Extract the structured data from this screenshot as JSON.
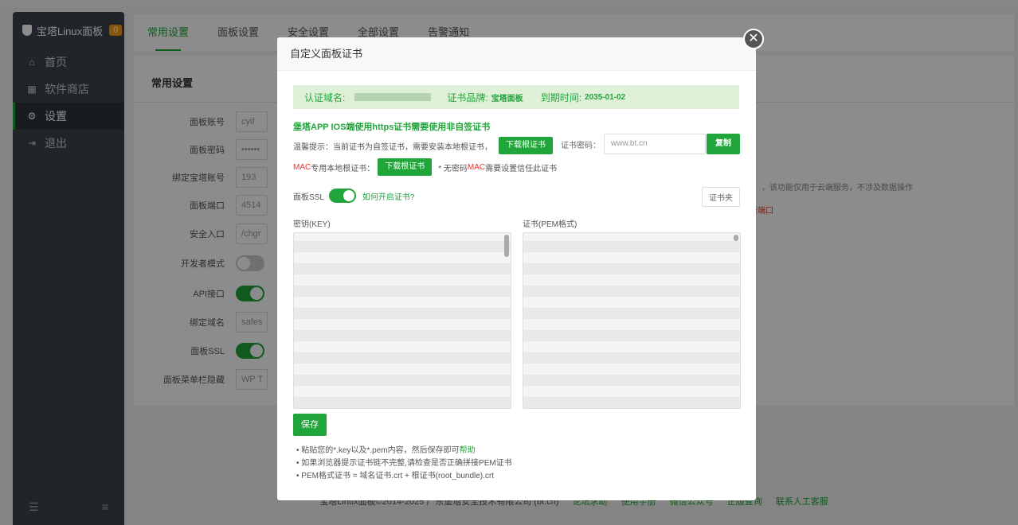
{
  "sidebar": {
    "title": "宝塔Linux面板",
    "badge": "0",
    "items": [
      {
        "label": "首页",
        "icon": "home-icon"
      },
      {
        "label": "软件商店",
        "icon": "grid-icon"
      },
      {
        "label": "设置",
        "icon": "gear-icon"
      },
      {
        "label": "退出",
        "icon": "logout-icon"
      }
    ]
  },
  "tabs": [
    "常用设置",
    "面板设置",
    "安全设置",
    "全部设置",
    "告警通知"
  ],
  "section_title": "常用设置",
  "settings": [
    {
      "label": "面板账号",
      "value": "cyif"
    },
    {
      "label": "面板密码",
      "value": "••••••"
    },
    {
      "label": "绑定宝塔账号",
      "value": "193"
    },
    {
      "label": "面板端口",
      "value": "4514"
    },
    {
      "label": "安全入口",
      "value": "/chgr"
    },
    {
      "label": "开发者模式"
    },
    {
      "label": "API接口"
    },
    {
      "label": "绑定域名",
      "value": "safes"
    },
    {
      "label": "面板SSL"
    },
    {
      "label": "面板菜单栏隐藏",
      "value": "WP T"
    }
  ],
  "side_note": "，该功能仅用于云端服务，不涉及数据操作",
  "side_red": "新端口",
  "footer": {
    "copyright": "宝塔Linux面板©2014-2025 广东堡塔安全技术有限公司 (bt.cn)",
    "links": [
      "论坛求助",
      "使用手册",
      "微信公众号",
      "正版查询",
      "联系人工客服"
    ]
  },
  "modal": {
    "title": "自定义面板证书",
    "domain_label": "认证域名:",
    "brand_label": "证书品牌:",
    "brand_value": "宝塔面板",
    "expire_label": "到期时间:",
    "expire_value": "2035-01-02",
    "ios_notice": "堡塔APP IOS端使用https证书需要使用非自签证书",
    "tip_text": "温馨提示：当前证书为自签证书，需要安装本地根证书，",
    "download_root": "下载根证书",
    "pw_label": "证书密码：",
    "pw_value": "www.bt.cn",
    "copy_label": "复制",
    "mac_prefix": "MAC",
    "mac_label": "专用本地根证书：",
    "mac_download": "下载根证书",
    "mac_note_a": "* 无密码 ",
    "mac_note_b": "MAC",
    "mac_note_c": "需要设置信任此证书",
    "ssl_label": "面板SSL",
    "ssl_help": "如何开启证书?",
    "cert_folder": "证书夹",
    "key_label": "密钥(KEY)",
    "pem_label": "证书(PEM格式)",
    "save_label": "保存",
    "notes": [
      {
        "text": "粘贴您的*.key以及*.pem内容，然后保存即可",
        "link": "帮助"
      },
      {
        "text": "如果浏览器提示证书链不完整,请检查是否正确拼接PEM证书",
        "link": ""
      },
      {
        "text": "PEM格式证书 = 域名证书.crt + 根证书(root_bundle).crt",
        "link": ""
      }
    ]
  },
  "colors": {
    "accent": "#20a53a",
    "sidebar": "#3c444d",
    "warning": "#e33"
  }
}
